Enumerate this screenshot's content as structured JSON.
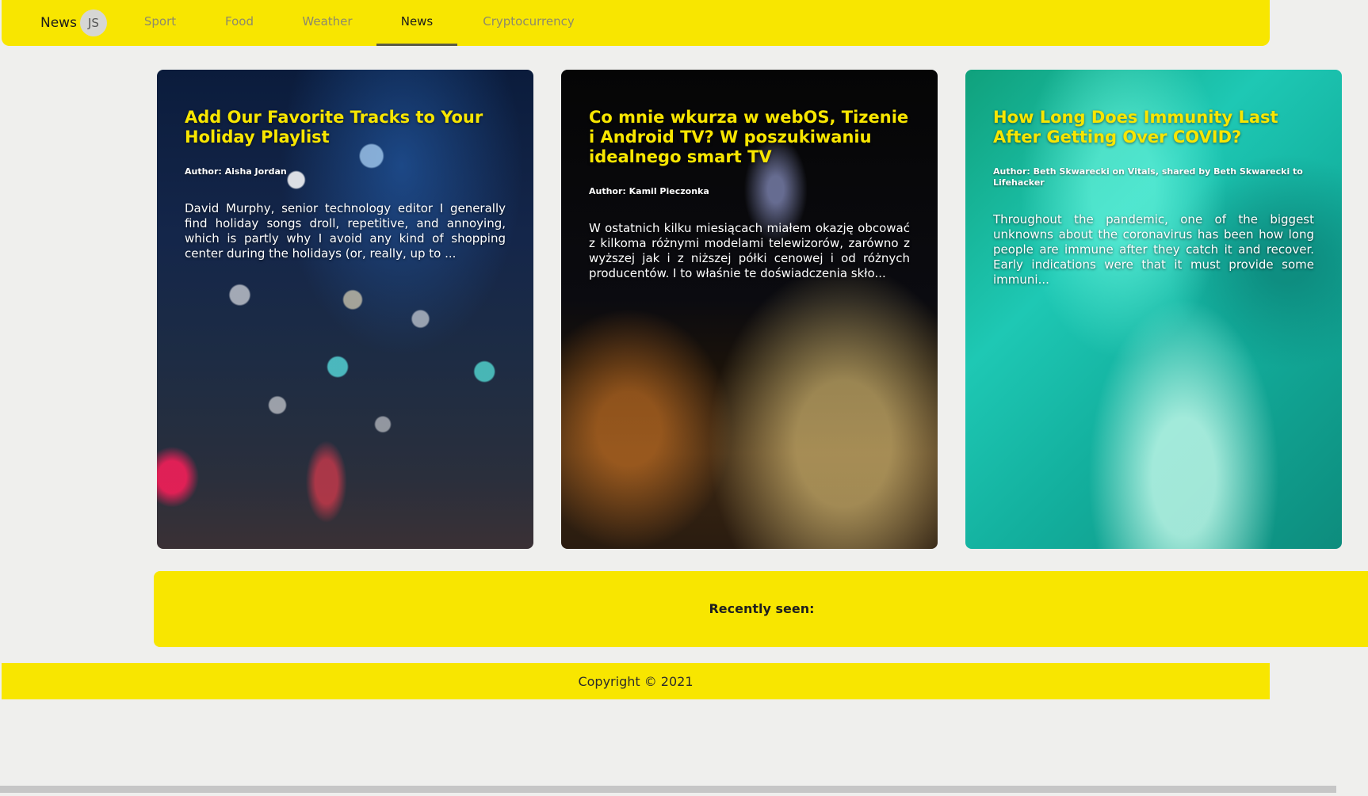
{
  "nav": {
    "brand_text": "News",
    "brand_badge": "JS",
    "tabs": [
      {
        "label": "Sport"
      },
      {
        "label": "Food"
      },
      {
        "label": "Weather"
      },
      {
        "label": "News",
        "active": true
      },
      {
        "label": "Cryptocurrency"
      }
    ]
  },
  "articles": [
    {
      "title": "Add Our Favorite Tracks to Your Holiday Playlist",
      "author": "Author: Aisha Jordan",
      "description": "David Murphy, senior technology editor I generally find holiday songs droll, repetitive, and annoying, which is partly why I avoid any kind of shopping center during the holidays (or, really, up to ..."
    },
    {
      "title": "Co mnie wkurza w webOS, Tizenie i Android TV? W poszukiwaniu idealnego smart TV",
      "author": "Author: Kamil Pieczonka",
      "description": "W ostatnich kilku miesiącach miałem okazję obcować z kilkoma różnymi modelami telewizorów, zarówno z wyższej jak i z niższej półki cenowej i od różnych producentów. I to właśnie te doświadczenia skło..."
    },
    {
      "title": "How Long Does Immunity Last After Getting Over COVID?",
      "author": "Author: Beth Skwarecki on Vitals, shared by Beth Skwarecki to Lifehacker",
      "description": "Throughout the pandemic, one of the biggest unknowns about the coronavirus has been how long people are immune after they catch it and recover. Early indications were that it must provide some immuni..."
    }
  ],
  "recent": {
    "title": "Recently seen:"
  },
  "footer": {
    "copyright": "Copyright © 2021"
  },
  "colors": {
    "accent": "#f8e600",
    "background": "#efefed"
  }
}
